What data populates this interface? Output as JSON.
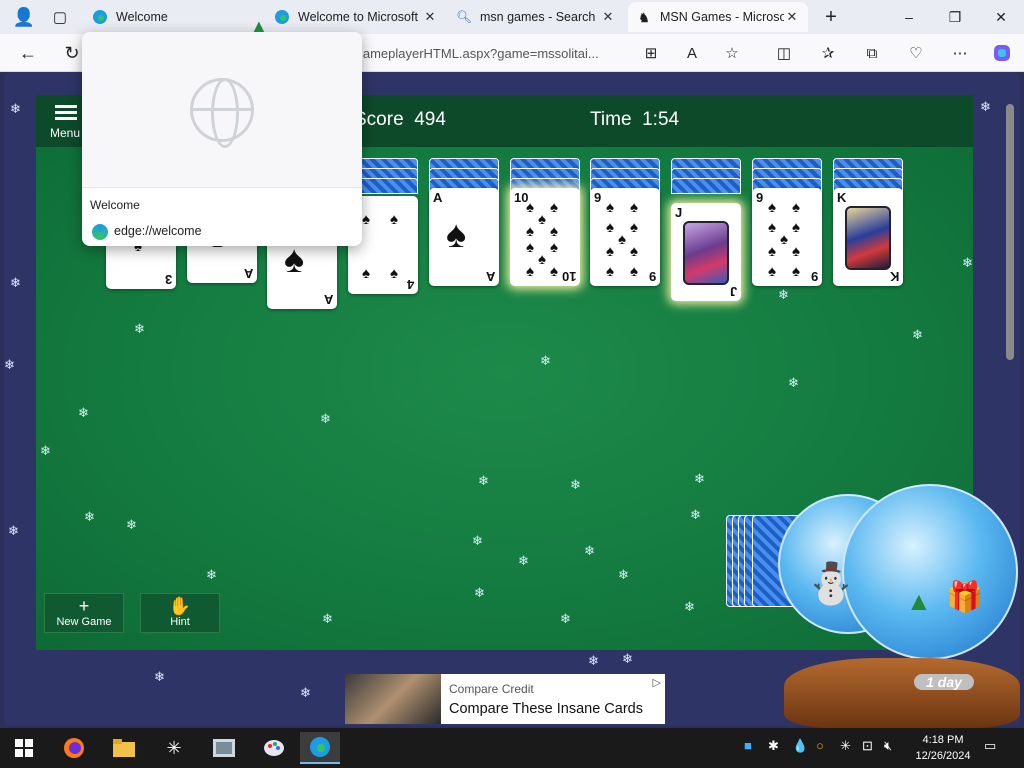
{
  "browser": {
    "tabs": [
      {
        "label": "Welcome",
        "icon": "edge-icon"
      },
      {
        "label": "Welcome to Microsoft",
        "icon": "edge-icon"
      },
      {
        "label": "msn games - Search",
        "icon": "search-icon"
      },
      {
        "label": "MSN Games - Microso",
        "icon": "msn-icon"
      }
    ],
    "new_tab": "+",
    "window_controls": {
      "minimize": "–",
      "maximize": "❐",
      "close": "✕"
    },
    "url": "/gameplayerHTML.aspx?game=mssolitai..."
  },
  "preview": {
    "title": "Welcome",
    "url": "edge://welcome"
  },
  "game": {
    "menu_label": "Menu",
    "score_label": "Score",
    "score_value": "494",
    "time_label": "Time",
    "time_value": "1:54",
    "new_game_label": "New Game",
    "hint_label": "Hint",
    "cards": [
      {
        "rank": "3"
      },
      {
        "rank": "A"
      },
      {
        "rank": "A"
      },
      {
        "rank": "4"
      },
      {
        "rank": "A"
      },
      {
        "rank": "10"
      },
      {
        "rank": "9"
      },
      {
        "rank": "J"
      },
      {
        "rank": "9"
      },
      {
        "rank": "K"
      }
    ],
    "face_down_counts": [
      0,
      0,
      0,
      3,
      3,
      3,
      3,
      3,
      3,
      3
    ]
  },
  "decoration": {
    "globe_label": "1 day"
  },
  "ad": {
    "source": "Compare Credit",
    "title": "Compare These Insane Cards",
    "info_icon": "▷"
  },
  "taskbar": {
    "time": "4:18 PM",
    "date": "12/26/2024"
  },
  "colors": {
    "felt": "#137a3f",
    "header": "#0d4a2a",
    "card_back": "#1d5fc5",
    "page_bg": "#2e3566"
  }
}
